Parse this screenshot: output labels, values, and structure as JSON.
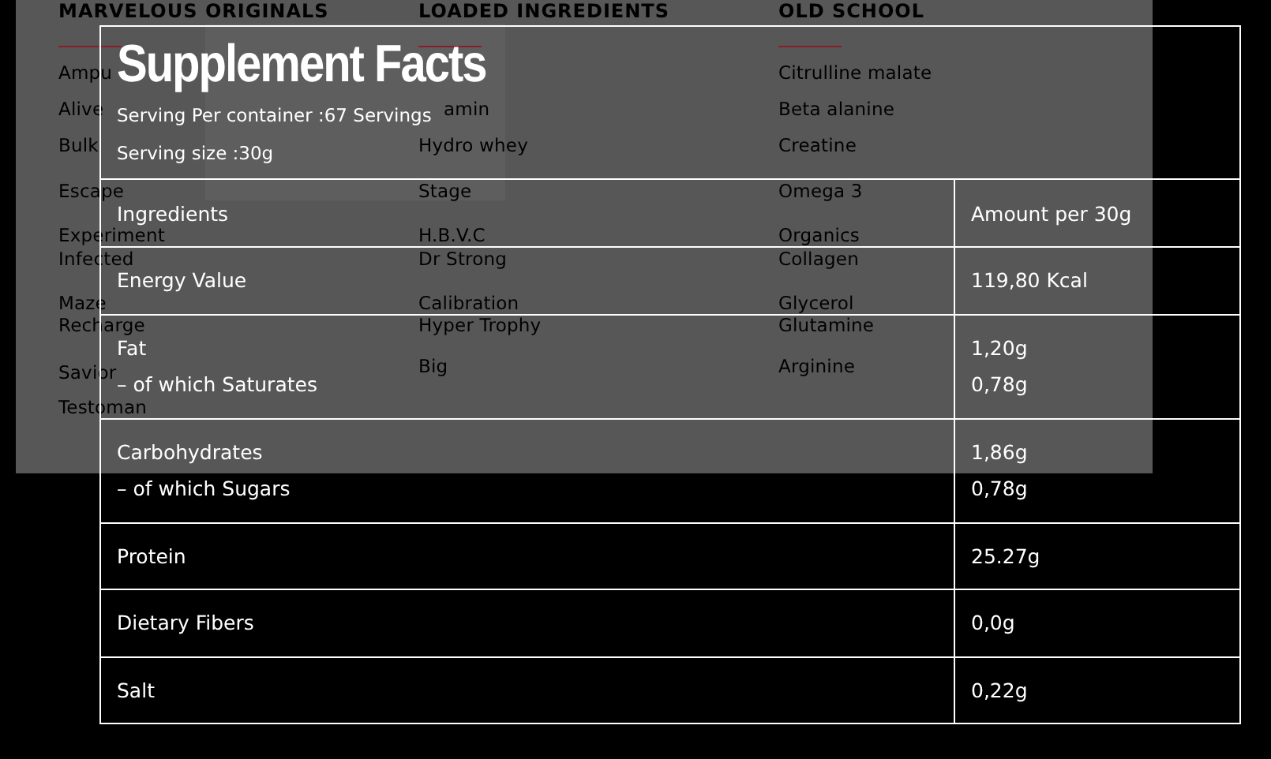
{
  "menu": {
    "columns": [
      {
        "heading": "MARVELOUS ORIGINALS",
        "items": [
          "Ampu",
          "Alive",
          "Bulk",
          "Escape",
          "Experiment",
          "Infected",
          "Maze",
          "Recharge",
          "Savior",
          "Testoman"
        ]
      },
      {
        "heading": "LOADED INGREDIENTS",
        "items": [
          "amin",
          "Hydro whey",
          "Stage",
          "H.B.V.C",
          "Dr Strong",
          "Calibration",
          "Hyper Trophy",
          "Big"
        ]
      },
      {
        "heading": "OLD SCHOOL",
        "items": [
          "Citrulline malate",
          "Beta alanine",
          "Creatine",
          "Omega 3",
          "Organics",
          "Collagen",
          "Glycerol",
          "Glutamine",
          "Arginine"
        ]
      }
    ]
  },
  "facts": {
    "title": "Supplement Facts",
    "serving_per_container": "Serving Per container :67 Servings",
    "serving_size": "Serving size :30g",
    "header": [
      "Ingredients",
      "Amount per 30g"
    ],
    "rows": [
      {
        "lines": [
          [
            "Energy Value",
            "119,80 Kcal"
          ]
        ]
      },
      {
        "lines": [
          [
            "Fat",
            "1,20g"
          ],
          [
            "– of which Saturates",
            "0,78g"
          ]
        ]
      },
      {
        "lines": [
          [
            "Carbohydrates",
            "1,86g"
          ],
          [
            "– of which Sugars",
            "0,78g"
          ]
        ]
      },
      {
        "lines": [
          [
            "Protein",
            "25.27g"
          ]
        ]
      },
      {
        "lines": [
          [
            "Dietary Fibers",
            "0,0g"
          ]
        ]
      },
      {
        "lines": [
          [
            "Salt",
            "0,22g"
          ]
        ]
      }
    ]
  }
}
